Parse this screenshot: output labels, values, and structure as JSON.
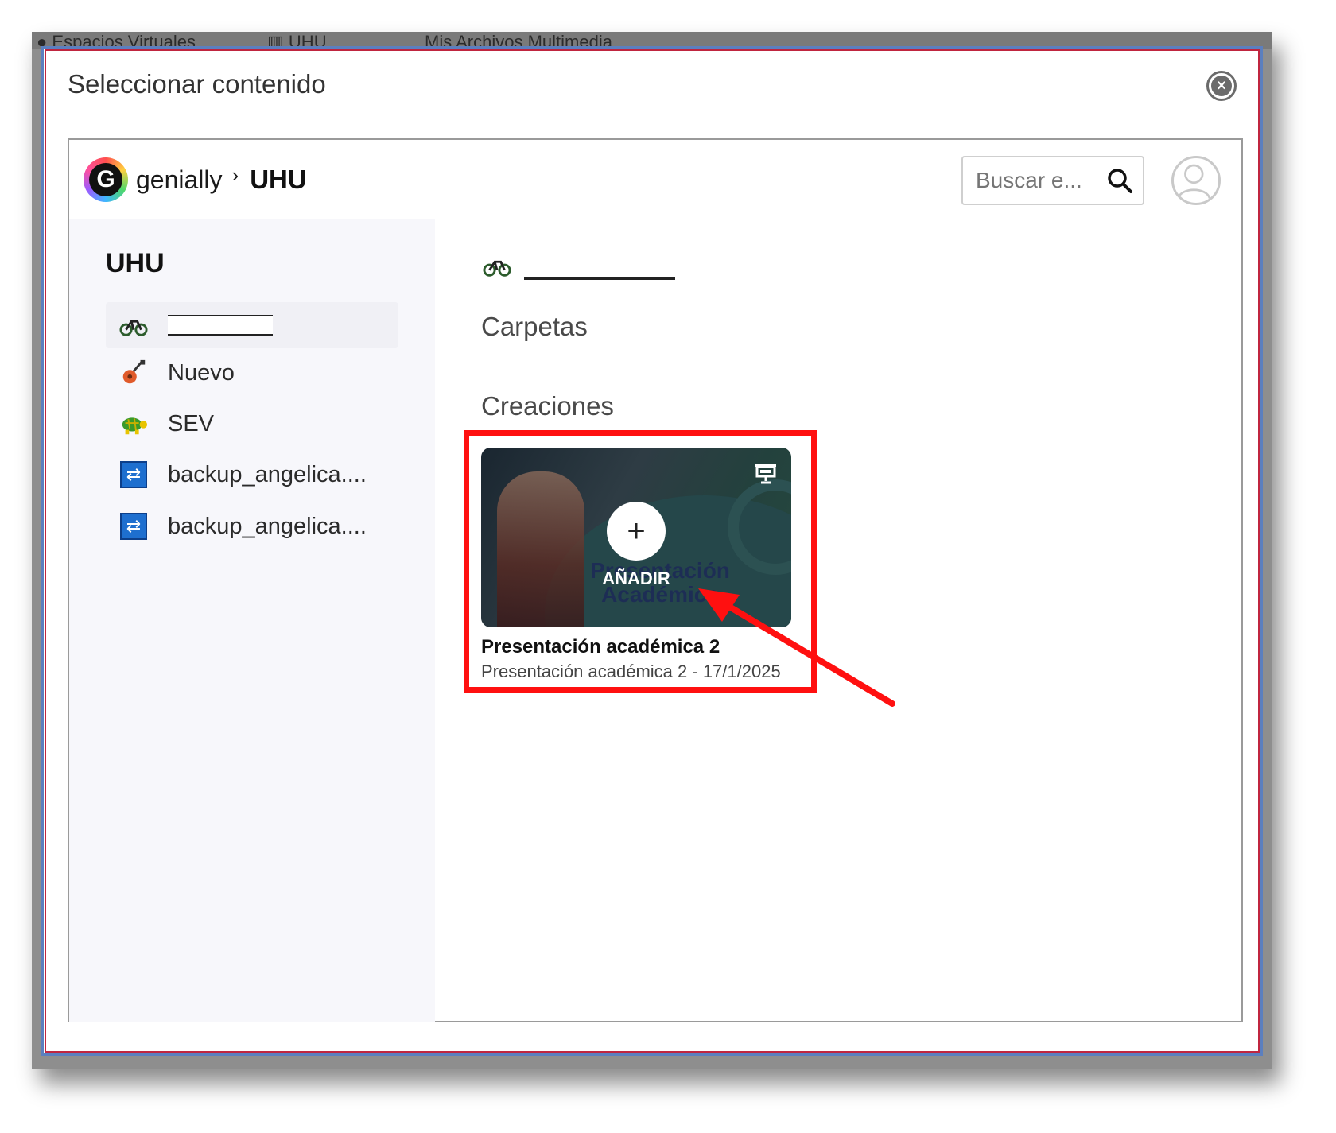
{
  "background": {
    "nav_items": [
      "Espacios Virtuales",
      "UHU",
      "Mis Archivos Multimedia"
    ]
  },
  "modal": {
    "title": "Seleccionar contenido"
  },
  "header": {
    "brand": "genially",
    "breadcrumb": "UHU",
    "search_placeholder": "Buscar e..."
  },
  "sidebar": {
    "title": "UHU",
    "items": [
      {
        "label": "",
        "icon": "bicycle-icon",
        "active": true
      },
      {
        "label": "Nuevo",
        "icon": "guitar-icon"
      },
      {
        "label": "SEV",
        "icon": "turtle-icon"
      },
      {
        "label": "backup_angelica....",
        "icon": "sync-icon"
      },
      {
        "label": "backup_angelica....",
        "icon": "sync-icon"
      }
    ]
  },
  "main": {
    "folders_label": "Carpetas",
    "creations_label": "Creaciones",
    "card": {
      "add_label": "AÑADIR",
      "background_title": "Presentación Académica",
      "title": "Presentación académica 2",
      "subtitle": "Presentación académica 2 - 17/1/2025"
    }
  },
  "colors": {
    "annotation_red": "#ff1010",
    "modal_border": "#5b7fbf",
    "sidebar_bg": "#f7f7fb"
  }
}
